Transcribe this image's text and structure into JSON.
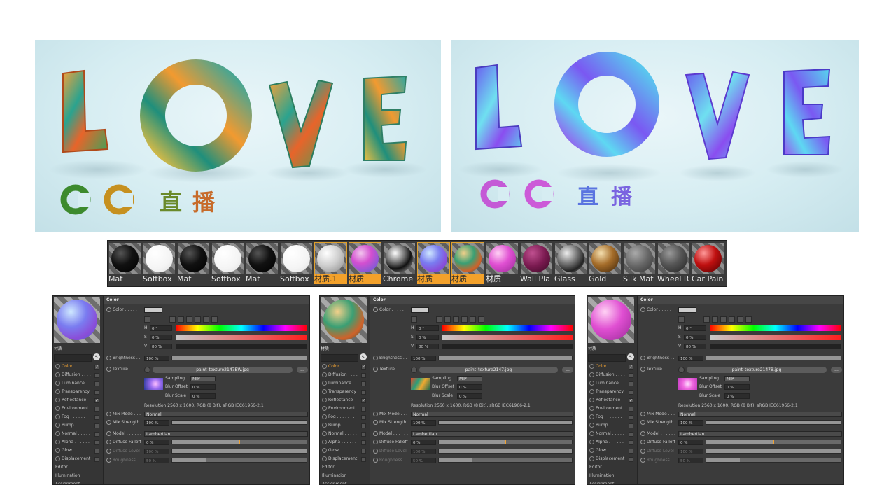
{
  "renders": {
    "left": {
      "letters": [
        "L",
        "O",
        "V",
        "E"
      ],
      "subtitle": [
        "C",
        "C",
        "直",
        "播"
      ],
      "palette": "warm"
    },
    "right": {
      "letters": [
        "L",
        "O",
        "V",
        "E"
      ],
      "subtitle": [
        "C",
        "C",
        "直",
        "播"
      ],
      "palette": "cool"
    }
  },
  "material_strip": {
    "items": [
      {
        "label": "Mat",
        "ball": "black",
        "selected": false
      },
      {
        "label": "Softbox",
        "ball": "white",
        "selected": false
      },
      {
        "label": "Mat",
        "ball": "black",
        "selected": false
      },
      {
        "label": "Softbox",
        "ball": "white",
        "selected": false
      },
      {
        "label": "Mat",
        "ball": "black",
        "selected": false
      },
      {
        "label": "Softbox",
        "ball": "white",
        "selected": false
      },
      {
        "label": "材质.1",
        "ball": "white-gloss",
        "selected": true
      },
      {
        "label": "材质",
        "ball": "pink-blue",
        "selected": true
      },
      {
        "label": "Chrome",
        "ball": "chrome",
        "selected": false
      },
      {
        "label": "材质",
        "ball": "blue-purple",
        "selected": true
      },
      {
        "label": "材质",
        "ball": "green-orange",
        "selected": true
      },
      {
        "label": "材质",
        "ball": "pink",
        "selected": false
      },
      {
        "label": "Wall Pla",
        "ball": "maroon",
        "selected": false
      },
      {
        "label": "Glass",
        "ball": "glass",
        "selected": false
      },
      {
        "label": "Gold",
        "ball": "gold",
        "selected": false
      },
      {
        "label": "Silk Mat",
        "ball": "grey",
        "selected": false
      },
      {
        "label": "Wheel R",
        "ball": "dark-grey",
        "selected": false
      },
      {
        "label": "Car Pain",
        "ball": "red",
        "selected": false
      }
    ]
  },
  "panels": [
    {
      "material_name": "材质",
      "ball": "blue-purple",
      "texture_file": "paint_texture2147BW.jpg",
      "tex_thumb": "purple",
      "channels": [
        {
          "label": "Color",
          "checked": true,
          "active": true
        },
        {
          "label": "Diffusion . . . .",
          "checked": false
        },
        {
          "label": "Luminance . .",
          "checked": false
        },
        {
          "label": "Transparency",
          "checked": false
        },
        {
          "label": "Reflectance",
          "checked": true
        },
        {
          "label": "Environment",
          "checked": false
        },
        {
          "label": "Fog . . . . . . .",
          "checked": false
        },
        {
          "label": "Bump . . . . . .",
          "checked": false
        },
        {
          "label": "Normal . . . . .",
          "checked": false
        },
        {
          "label": "Alpha . . . . . .",
          "checked": false
        },
        {
          "label": "Glow . . . . . . .",
          "checked": false
        },
        {
          "label": "Displacement",
          "checked": false
        },
        {
          "label": "Editor",
          "checked": null
        },
        {
          "label": "Illumination",
          "checked": null
        },
        {
          "label": "Assignment",
          "checked": null
        }
      ]
    },
    {
      "material_name": "材质",
      "ball": "green-orange",
      "texture_file": "paint_texture2147.jpg",
      "tex_thumb": "multicolor",
      "channels": [
        {
          "label": "Color",
          "checked": true,
          "active": true
        },
        {
          "label": "Diffusion . . . .",
          "checked": false
        },
        {
          "label": "Luminance . .",
          "checked": false
        },
        {
          "label": "Transparency",
          "checked": false
        },
        {
          "label": "Reflectance",
          "checked": true
        },
        {
          "label": "Environment",
          "checked": false
        },
        {
          "label": "Fog . . . . . . .",
          "checked": false
        },
        {
          "label": "Bump . . . . . .",
          "checked": false
        },
        {
          "label": "Normal . . . . .",
          "checked": false
        },
        {
          "label": "Alpha . . . . . .",
          "checked": false
        },
        {
          "label": "Glow . . . . . . .",
          "checked": false
        },
        {
          "label": "Displacement",
          "checked": false
        },
        {
          "label": "Editor",
          "checked": null
        },
        {
          "label": "Illumination",
          "checked": null
        },
        {
          "label": "Assignment",
          "checked": null
        }
      ]
    },
    {
      "material_name": "材质",
      "ball": "pink",
      "texture_file": "paint_texture2147B.jpg",
      "tex_thumb": "pink",
      "channels": [
        {
          "label": "Color",
          "checked": true,
          "active": true
        },
        {
          "label": "Diffusion . . . .",
          "checked": false
        },
        {
          "label": "Luminance . .",
          "checked": false
        },
        {
          "label": "Transparency",
          "checked": false
        },
        {
          "label": "Reflectance",
          "checked": true
        },
        {
          "label": "Environment",
          "checked": false
        },
        {
          "label": "Fog . . . . . . .",
          "checked": false
        },
        {
          "label": "Bump . . . . . .",
          "checked": false
        },
        {
          "label": "Normal . . . . .",
          "checked": false
        },
        {
          "label": "Alpha . . . . . .",
          "checked": false
        },
        {
          "label": "Glow . . . . . . .",
          "checked": false
        },
        {
          "label": "Displacement",
          "checked": false
        },
        {
          "label": "Editor",
          "checked": null
        },
        {
          "label": "Illumination",
          "checked": null
        },
        {
          "label": "Assignment",
          "checked": null
        }
      ]
    }
  ],
  "panel_common": {
    "header": "Color",
    "color_label": "Color . . . . .",
    "h_label": "H",
    "h_value": "0 °",
    "s_label": "S",
    "s_value": "0 %",
    "v_label": "V",
    "v_value": "80 %",
    "brightness_label": "Brightness . .",
    "brightness_value": "100 %",
    "texture_label": "Texture . . . . .",
    "texture_more": "...",
    "sampling_label": "Sampling",
    "sampling_value": "MIP",
    "blur_offset_label": "Blur Offset",
    "blur_offset_value": "0 %",
    "blur_scale_label": "Blur Scale",
    "blur_scale_value": "0 %",
    "resolution": "Resolution 2560 x 1600, RGB (8 Bit), sRGB IEC61966-2.1",
    "mix_mode_label": "Mix Mode . . .",
    "mix_mode_value": "Normal",
    "mix_strength_label": "Mix Strength",
    "mix_strength_value": "100 %",
    "model_label": "Model . . . . . .",
    "model_value": "Lambertian",
    "diffuse_falloff_label": "Diffuse Falloff",
    "diffuse_falloff_value": "0 %",
    "diffuse_level_label": "Diffuse Level",
    "diffuse_level_value": "100 %",
    "roughness_label": "Roughness . .",
    "roughness_value": "50 %",
    "v_level": 0.8,
    "falloff_tick": 0.5
  },
  "colors": {
    "accent": "#f3a12a",
    "panel_bg": "#3b3b3b",
    "render_bg": "#d6edf2"
  }
}
